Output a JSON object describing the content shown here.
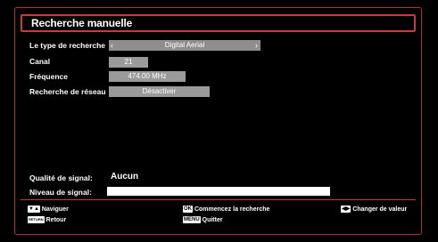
{
  "title": "Recherche manuelle",
  "fields": {
    "search_type": {
      "label": "Le type de recherche",
      "value": "Digital Aerial"
    },
    "channel": {
      "label": "Canal",
      "value": "21"
    },
    "frequency": {
      "label": "Fréquence",
      "value": "474.00 MHz"
    },
    "network_search": {
      "label": "Recherche de réseau",
      "value": "Désactiver"
    }
  },
  "signal": {
    "quality_label": "Qualité de signal:",
    "quality_value": "Aucun",
    "level_label": "Niveau de signal:",
    "level": 0
  },
  "footer": {
    "navigate": "Naviguer",
    "return_key": "RETURN",
    "return": "Retour",
    "ok_key": "OK",
    "start_search": "Commencez la recherche",
    "menu_key": "MENU",
    "quit": "Quitter",
    "change_value": "Changer de valeur"
  },
  "colors": {
    "frame": "#c43a45",
    "field_bg": "#9a9a9a"
  }
}
